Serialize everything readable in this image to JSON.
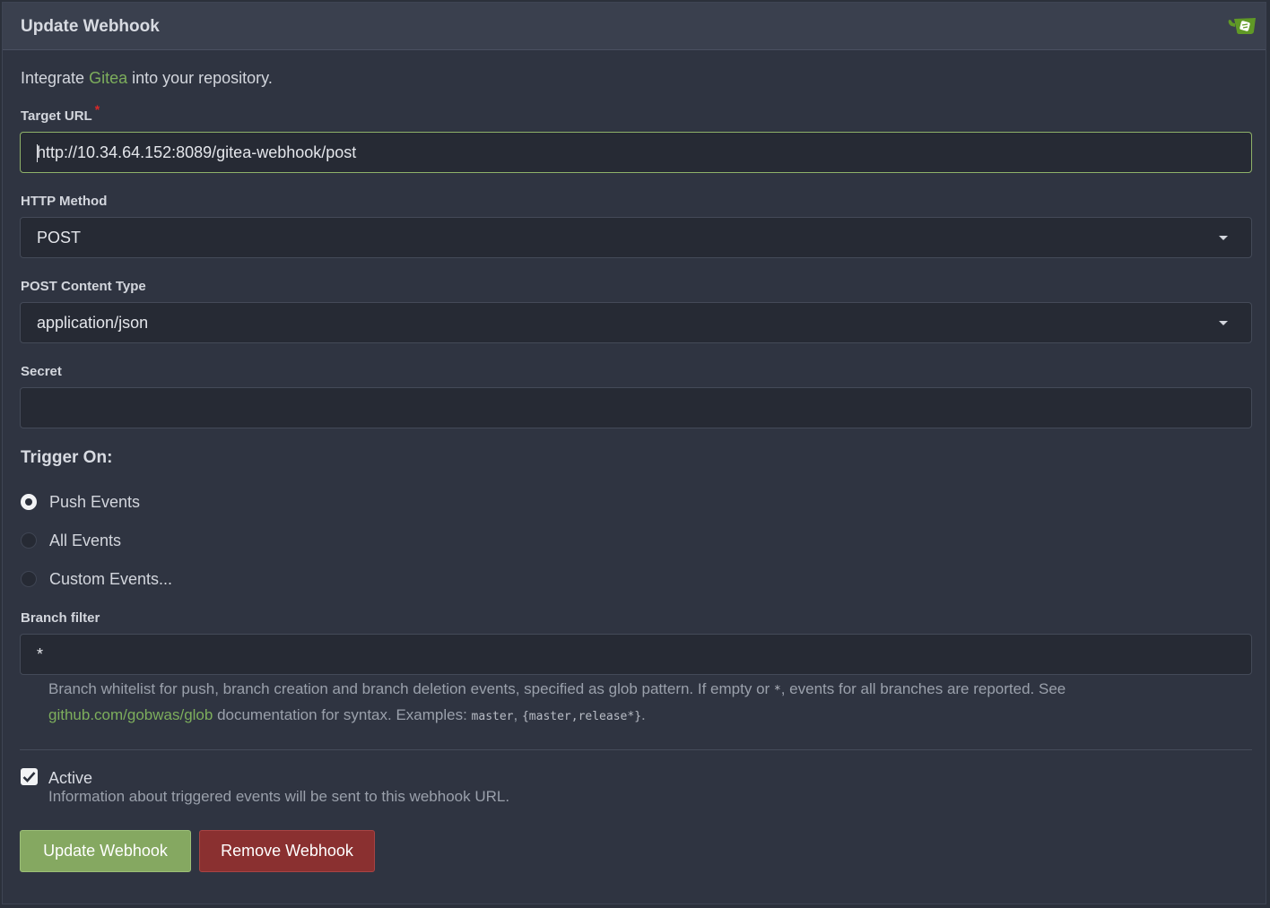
{
  "header": {
    "title": "Update Webhook",
    "logo_icon": "gitea-logo-icon"
  },
  "intro": {
    "prefix": "Integrate ",
    "link": "Gitea",
    "suffix": " into your repository."
  },
  "target_url": {
    "label": "Target URL",
    "required_marker": "*",
    "value": "http://10.34.64.152:8089/gitea-webhook/post"
  },
  "http_method": {
    "label": "HTTP Method",
    "value": "POST"
  },
  "content_type": {
    "label": "POST Content Type",
    "value": "application/json"
  },
  "secret": {
    "label": "Secret",
    "value": ""
  },
  "trigger": {
    "heading": "Trigger On:",
    "options": [
      {
        "label": "Push Events",
        "checked": true
      },
      {
        "label": "All Events",
        "checked": false
      },
      {
        "label": "Custom Events...",
        "checked": false
      }
    ]
  },
  "branch_filter": {
    "label": "Branch filter",
    "value": "*",
    "help_part1": "Branch whitelist for push, branch creation and branch deletion events, specified as glob pattern. If empty or ",
    "help_code1": "*",
    "help_part2": ", events for all branches are reported. See",
    "help_link": "github.com/gobwas/glob",
    "help_part3": " documentation for syntax. Examples: ",
    "help_code2": "master",
    "help_sep": ", ",
    "help_code3": "{master,release*}",
    "help_end": "."
  },
  "active": {
    "label": "Active",
    "checked": true,
    "description": "Information about triggered events will be sent to this webhook URL."
  },
  "buttons": {
    "update": "Update Webhook",
    "remove": "Remove Webhook"
  },
  "colors": {
    "accent_green": "#85a861",
    "danger_red": "#8a3030",
    "link_green": "#7dae5c"
  }
}
